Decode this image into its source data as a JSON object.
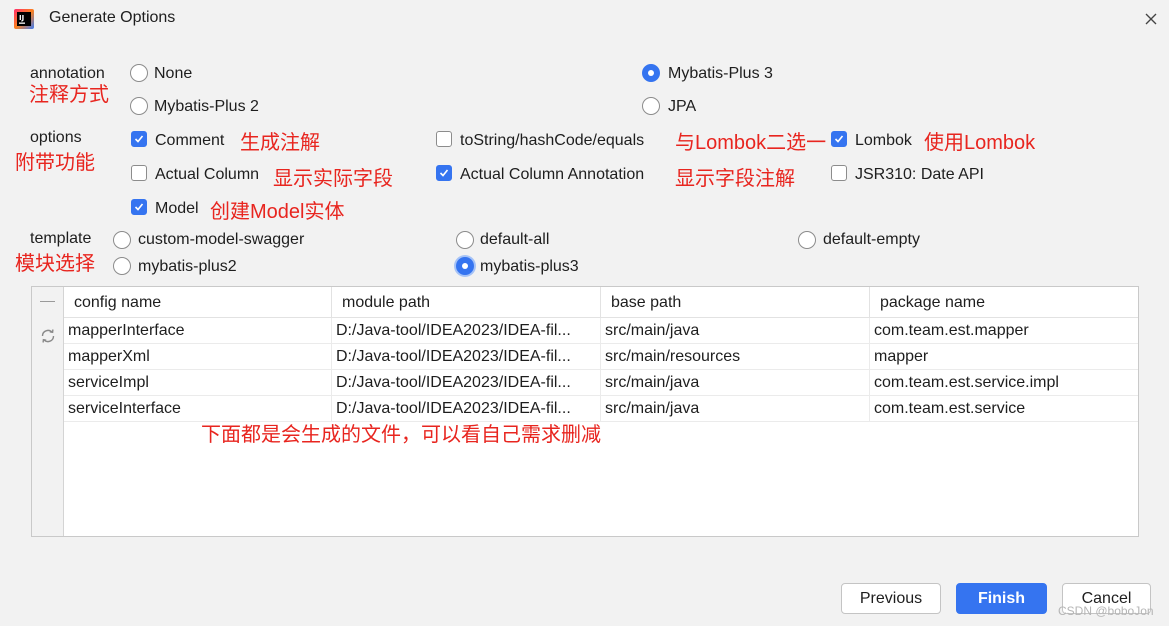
{
  "window": {
    "title": "Generate Options"
  },
  "annotation": {
    "label": "annotation",
    "note": "注释方式",
    "options": [
      {
        "label": "None",
        "selected": false
      },
      {
        "label": "Mybatis-Plus 3",
        "selected": true
      },
      {
        "label": "Mybatis-Plus 2",
        "selected": false
      },
      {
        "label": "JPA",
        "selected": false
      }
    ]
  },
  "options": {
    "label": "options",
    "note": "附带功能",
    "items": [
      {
        "label": "Comment",
        "checked": true,
        "note": "生成注解"
      },
      {
        "label": "toString/hashCode/equals",
        "checked": false,
        "note": "与Lombok二选一"
      },
      {
        "label": "Lombok",
        "checked": true,
        "note": "使用Lombok"
      },
      {
        "label": "Actual Column",
        "checked": false,
        "note": "显示实际字段"
      },
      {
        "label": "Actual Column Annotation",
        "checked": true,
        "note": "显示字段注解"
      },
      {
        "label": "JSR310: Date API",
        "checked": false,
        "note": ""
      },
      {
        "label": "Model",
        "checked": true,
        "note": "创建Model实体"
      }
    ]
  },
  "template": {
    "label": "template",
    "note": "模块选择",
    "options": [
      {
        "label": "custom-model-swagger",
        "selected": false
      },
      {
        "label": "default-all",
        "selected": false
      },
      {
        "label": "default-empty",
        "selected": false
      },
      {
        "label": "mybatis-plus2",
        "selected": false
      },
      {
        "label": "mybatis-plus3",
        "selected": true
      }
    ]
  },
  "table": {
    "columns": [
      "config name",
      "module path",
      "base path",
      "package name"
    ],
    "rows": [
      [
        "mapperInterface",
        "D:/Java-tool/IDEA2023/IDEA-fil...",
        "src/main/java",
        "com.team.est.mapper"
      ],
      [
        "mapperXml",
        "D:/Java-tool/IDEA2023/IDEA-fil...",
        "src/main/resources",
        "mapper"
      ],
      [
        "serviceImpl",
        "D:/Java-tool/IDEA2023/IDEA-fil...",
        "src/main/java",
        "com.team.est.service.impl"
      ],
      [
        "serviceInterface",
        "D:/Java-tool/IDEA2023/IDEA-fil...",
        "src/main/java",
        "com.team.est.service"
      ]
    ],
    "note": "下面都是会生成的文件，可以看自己需求删减"
  },
  "buttons": {
    "previous": "Previous",
    "finish": "Finish",
    "cancel": "Cancel"
  },
  "watermark": "CSDN @boboJon",
  "colors": {
    "accent": "#3574f0",
    "annotation_red": "#e8251f"
  },
  "icons": {
    "app": "intellij-idea-logo-icon",
    "close": "close-icon",
    "refresh": "refresh-icon"
  }
}
